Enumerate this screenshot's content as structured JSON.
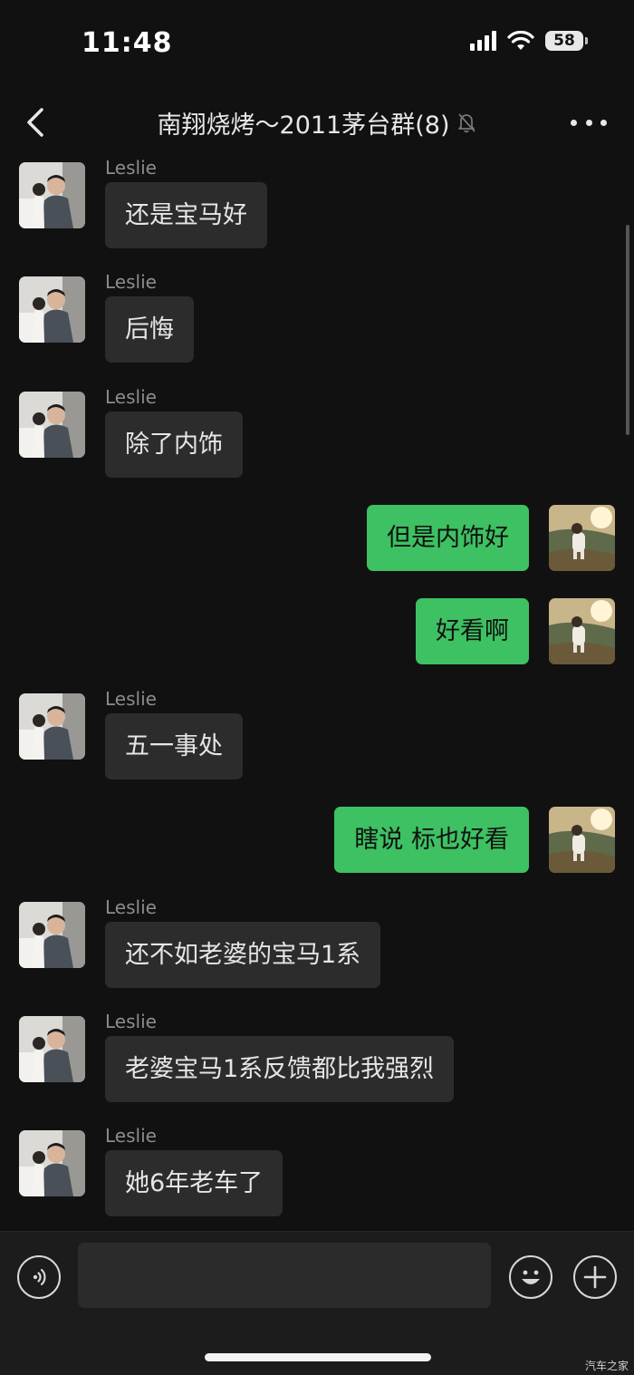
{
  "status_bar": {
    "time": "11:48",
    "battery": "58",
    "icons": [
      "cellular-signal-icon",
      "wifi-icon",
      "battery-icon"
    ]
  },
  "nav": {
    "title": "南翔烧烤～2011茅台群(8)",
    "icons": [
      "back-chevron-icon",
      "mute-bell-icon",
      "more-dots-icon"
    ]
  },
  "messages": [
    {
      "side": "left",
      "sender": "Leslie",
      "text": "还是宝马好"
    },
    {
      "side": "left",
      "sender": "Leslie",
      "text": "后悔"
    },
    {
      "side": "left",
      "sender": "Leslie",
      "text": "除了内饰"
    },
    {
      "side": "right",
      "text": "但是内饰好"
    },
    {
      "side": "right",
      "text": "好看啊"
    },
    {
      "side": "left",
      "sender": "Leslie",
      "text": "五一事处"
    },
    {
      "side": "right",
      "text": "瞎说 标也好看"
    },
    {
      "side": "left",
      "sender": "Leslie",
      "text": "还不如老婆的宝马1系"
    },
    {
      "side": "left",
      "sender": "Leslie",
      "text": "老婆宝马1系反馈都比我强烈"
    },
    {
      "side": "left",
      "sender": "Leslie",
      "text": "她6年老车了"
    }
  ],
  "input_bar": {
    "placeholder": "",
    "icons": [
      "voice-icon",
      "emoji-icon",
      "plus-icon"
    ]
  },
  "watermark": "汽车之家",
  "colors": {
    "background": "#111111",
    "incoming_bubble": "#2c2c2c",
    "outgoing_bubble": "#3dc162",
    "sender_name": "#8c8c8c"
  }
}
